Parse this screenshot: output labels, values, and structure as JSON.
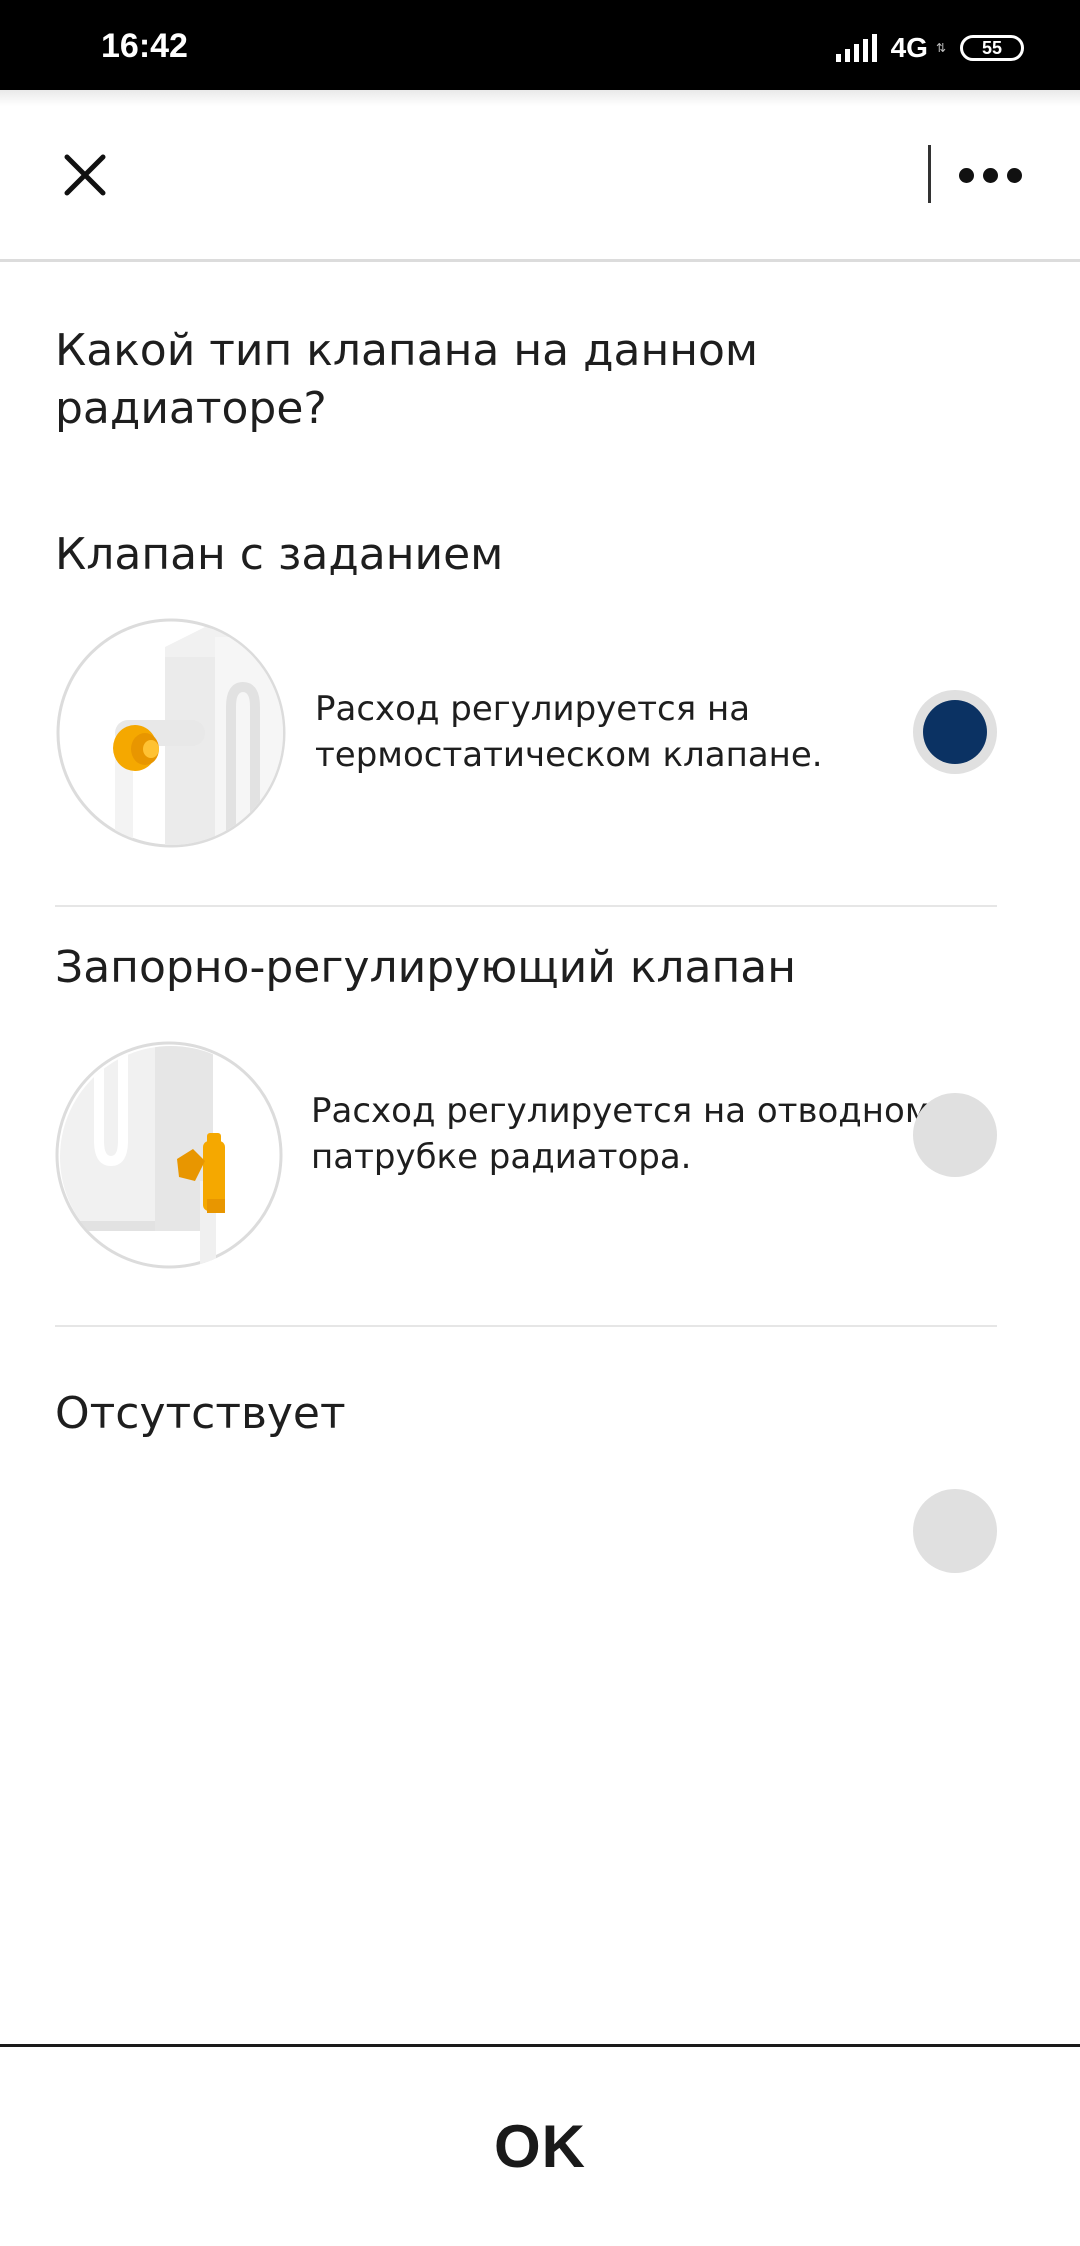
{
  "status_bar": {
    "time": "16:42",
    "network": "4G",
    "battery": "55"
  },
  "header": {
    "close_icon": "close-icon",
    "more_icon": "more-horizontal-icon"
  },
  "question": "Какой тип клапана на данном радиаторе?",
  "options": [
    {
      "title": "Клапан с заданием",
      "description": "Расход регулируется на термостатическом клапане.",
      "selected": true
    },
    {
      "title": "Запорно-регулирующий клапан",
      "description": "Расход регулируется на отводном патрубке радиатора.",
      "selected": false
    },
    {
      "title": "Отсутствует",
      "description": "",
      "selected": false
    }
  ],
  "ok_label": "OK",
  "colors": {
    "accent": "#0b3263",
    "valve": "#f5a800",
    "radio_bg": "#e0e0e0"
  }
}
